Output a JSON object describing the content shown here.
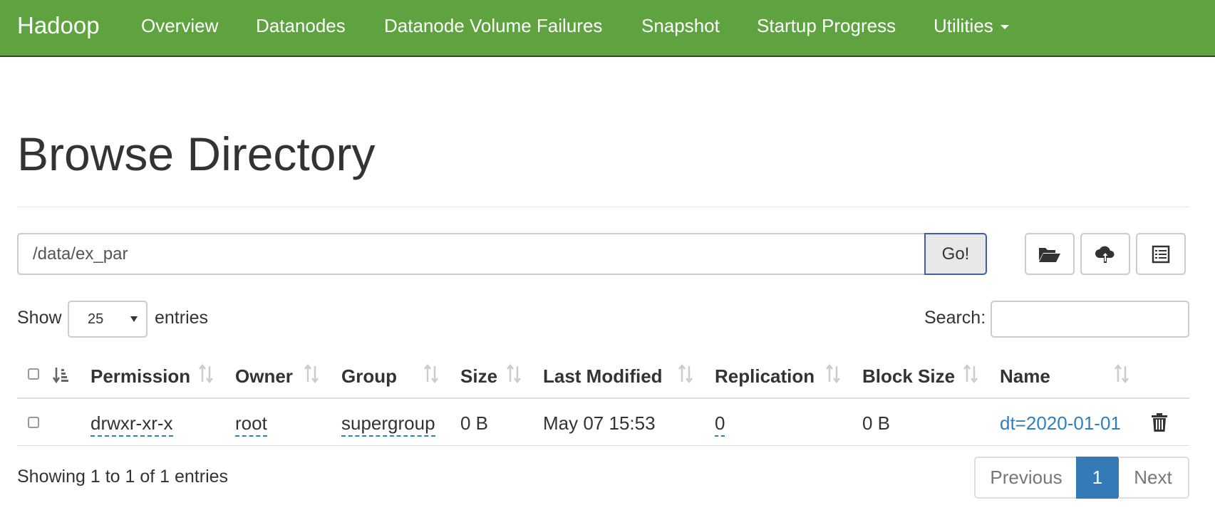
{
  "navbar": {
    "brand": "Hadoop",
    "items": [
      "Overview",
      "Datanodes",
      "Datanode Volume Failures",
      "Snapshot",
      "Startup Progress",
      "Utilities"
    ],
    "color": "#5fa341"
  },
  "page": {
    "title": "Browse Directory"
  },
  "path_bar": {
    "value": "/data/ex_par",
    "go_label": "Go!"
  },
  "toolbar": {
    "icons": [
      "folder-open-icon",
      "cloud-upload-icon",
      "list-alt-icon"
    ]
  },
  "table_controls": {
    "show_label": "Show",
    "entries_per_page": "25",
    "entries_label": "entries",
    "search_label": "Search:",
    "search_value": ""
  },
  "table": {
    "columns": [
      "Permission",
      "Owner",
      "Group",
      "Size",
      "Last Modified",
      "Replication",
      "Block Size",
      "Name"
    ],
    "rows": [
      {
        "permission": "drwxr-xr-x",
        "owner": "root",
        "group": "supergroup",
        "size": "0 B",
        "last_modified": "May 07 15:53",
        "replication": "0",
        "block_size": "0 B",
        "name": "dt=2020-01-01"
      }
    ]
  },
  "footer": {
    "info": "Showing 1 to 1 of 1 entries",
    "pagination": {
      "previous": "Previous",
      "current": "1",
      "next": "Next"
    }
  },
  "colors": {
    "link": "#2e7fc4",
    "active_page": "#337ab7"
  }
}
